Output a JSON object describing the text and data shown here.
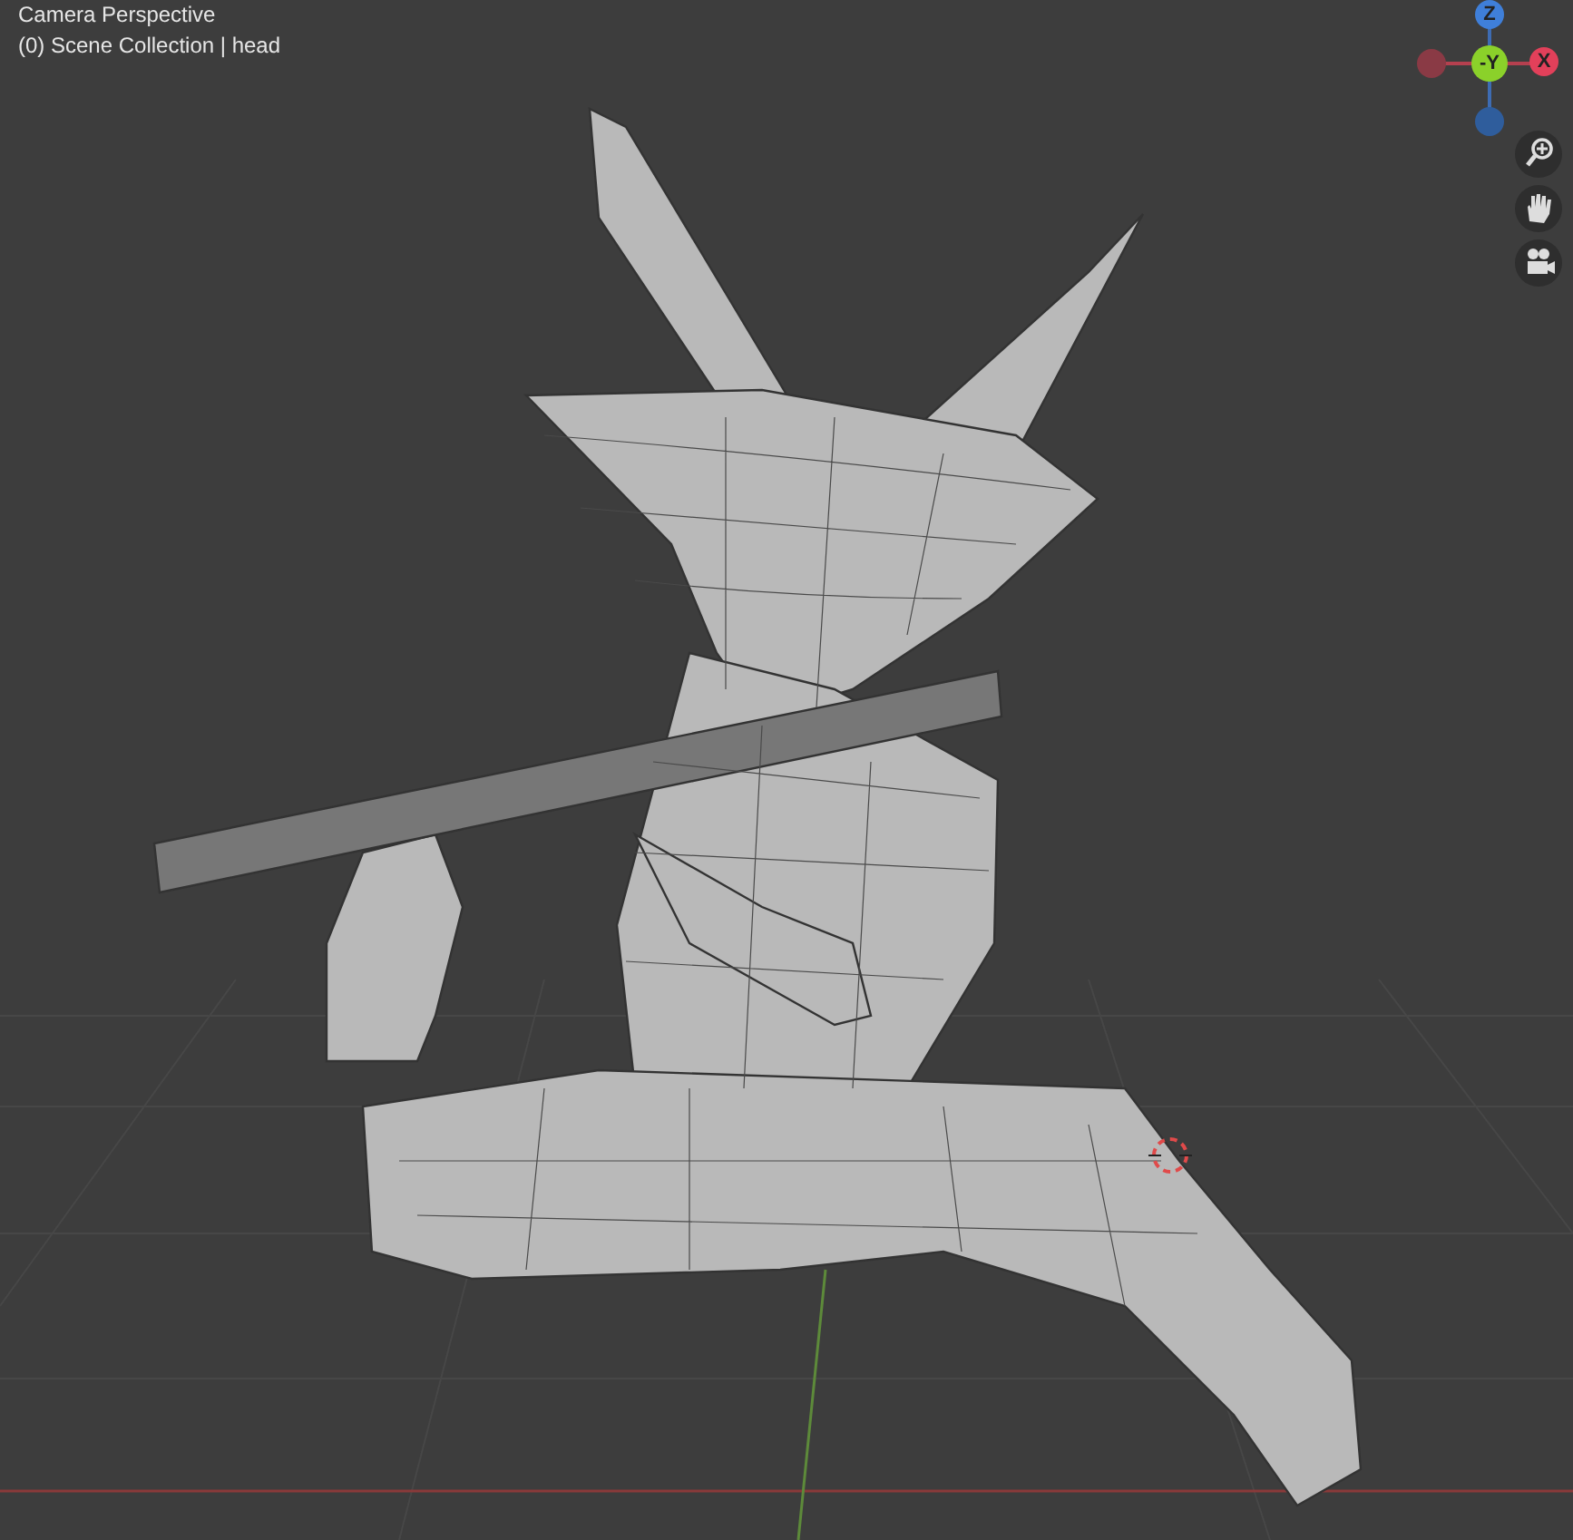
{
  "viewport": {
    "view_name": "Camera Perspective",
    "collection_label": "(0) Scene Collection | head"
  },
  "gizmo": {
    "axes": [
      {
        "label": "Z",
        "kind": "top"
      },
      {
        "label": "-Y",
        "kind": "center"
      },
      {
        "label": "X",
        "kind": "right"
      },
      {
        "kind": "left"
      },
      {
        "kind": "bottom"
      }
    ]
  },
  "tools": [
    {
      "kind": "zoom"
    },
    {
      "kind": "pan"
    },
    {
      "kind": "camera"
    }
  ]
}
